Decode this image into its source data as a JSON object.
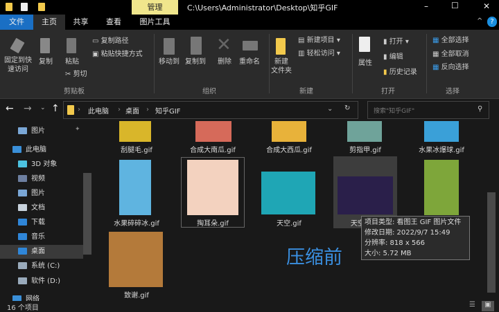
{
  "window": {
    "title": "C:\\Users\\Administrator\\Desktop\\知乎GIF",
    "context_tab": "管理",
    "minimize": "–",
    "maximize": "☐",
    "close": "✕"
  },
  "tabs": [
    "文件",
    "主页",
    "共享",
    "查看",
    "图片工具"
  ],
  "ribbon": {
    "clipboard": {
      "pin": "固定到快\n速访问",
      "copy": "复制",
      "paste": "粘贴",
      "copy_path": "复制路径",
      "paste_shortcut": "粘贴快捷方式",
      "cut": "剪切",
      "group": "剪贴板"
    },
    "organize": {
      "move_to": "移动到",
      "copy_to": "复制到",
      "delete": "删除",
      "rename": "重命名",
      "group": "组织"
    },
    "new": {
      "new_folder": "新建\n文件夹",
      "new_item": "新建项目 ▾",
      "easy_access": "轻松访问 ▾",
      "group": "新建"
    },
    "open": {
      "properties": "属性",
      "open": "打开 ▾",
      "edit": "编辑",
      "history": "历史记录",
      "group": "打开"
    },
    "select": {
      "select_all": "全部选择",
      "select_none": "全部取消",
      "invert": "反向选择",
      "group": "选择"
    }
  },
  "nav": {
    "breadcrumb": [
      "此电脑",
      "桌面",
      "知乎GIF"
    ],
    "search_placeholder": "搜索\"知乎GIF\""
  },
  "sidebar": [
    {
      "label": "图片",
      "color": "#7aa7d6"
    },
    {
      "label": "此电脑",
      "color": "#3a8fd8"
    },
    {
      "label": "3D 对象",
      "color": "#4cc2e0"
    },
    {
      "label": "视频",
      "color": "#6d7fa0"
    },
    {
      "label": "图片",
      "color": "#7aa7d6"
    },
    {
      "label": "文档",
      "color": "#c8d2dc"
    },
    {
      "label": "下载",
      "color": "#2f86d8"
    },
    {
      "label": "音乐",
      "color": "#2f86d8"
    },
    {
      "label": "桌面",
      "color": "#2f86d8"
    },
    {
      "label": "系统 (C:)",
      "color": "#9ab"
    },
    {
      "label": "软件 (D:)",
      "color": "#9ab"
    },
    {
      "label": "网络",
      "color": "#3a8fd8"
    }
  ],
  "files": [
    {
      "name": "刮腿毛.gif",
      "color": "#d9b62a"
    },
    {
      "name": "合成大南瓜.gif",
      "color": "#d66a5a"
    },
    {
      "name": "合成大西瓜.gif",
      "color": "#e8b23a"
    },
    {
      "name": "剪指甲.gif",
      "color": "#6fa39a"
    },
    {
      "name": "水果冰爆球.gif",
      "color": "#3aa0d8"
    },
    {
      "name": "水果碎碎冰.gif",
      "color": "#5fb4e0"
    },
    {
      "name": "掏耳朵.gif",
      "color": "#f3d2bf"
    },
    {
      "name": "天空.gif",
      "color": "#1fa6b5"
    },
    {
      "name": "天空2.gif",
      "color": "#2a1f4a"
    },
    {
      "name": "",
      "color": "#7ea63a"
    },
    {
      "name": "致谢.gif",
      "color": "#b47a3a"
    }
  ],
  "tooltip": [
    "项目类型: 看图王 GIF 图片文件",
    "修改日期: 2022/9/7 15:49",
    "分辨率: 818 x 566",
    "大小: 5.72 MB"
  ],
  "watermark": "压缩前",
  "status": {
    "count": "16 个项目"
  }
}
